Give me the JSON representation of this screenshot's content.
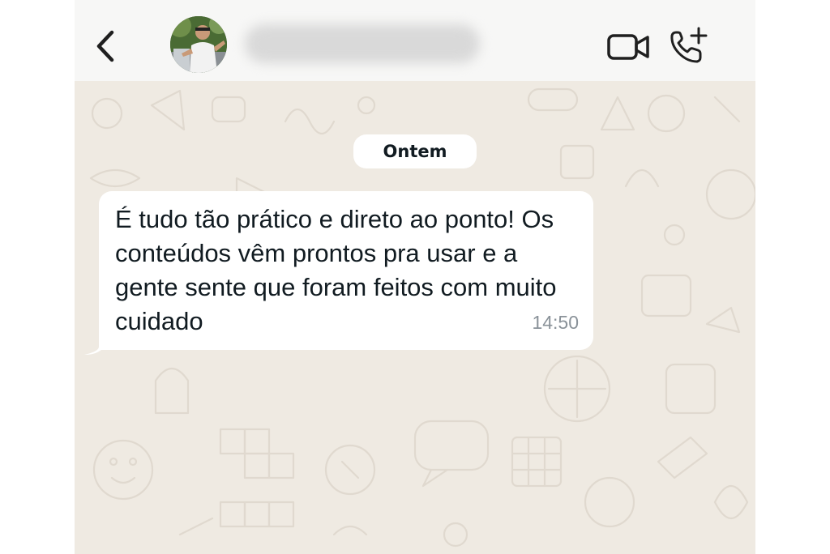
{
  "header": {
    "back_icon": "chevron-left-icon",
    "contact_name": "",
    "video_icon": "video-camera-icon",
    "call_icon": "phone-add-icon"
  },
  "chat": {
    "date_separator": "Ontem",
    "messages": [
      {
        "text": "É tudo tão prático e direto ao ponto! Os conteúdos vêm prontos pra usar e a gente sente que foram feitos com muito cuidado",
        "time": "14:50",
        "direction": "incoming"
      }
    ]
  },
  "colors": {
    "wallpaper": "#efeae2",
    "header": "#f7f7f6",
    "bubble": "#ffffff",
    "time": "#8a9299",
    "icon": "#1f1f1f"
  }
}
